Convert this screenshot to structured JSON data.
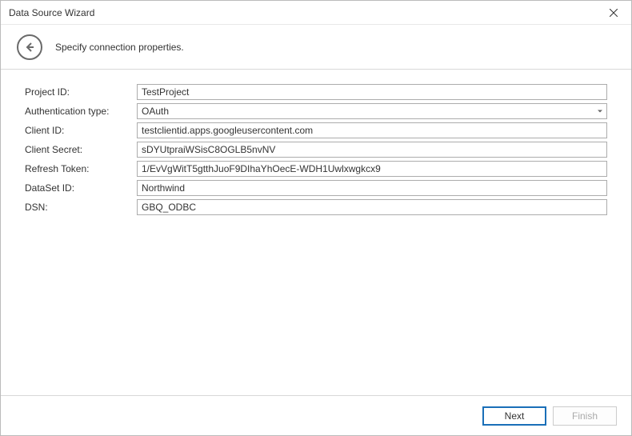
{
  "window": {
    "title": "Data Source Wizard"
  },
  "header": {
    "subtitle": "Specify connection properties."
  },
  "form": {
    "project_id_label": "Project ID:",
    "project_id_value": "TestProject",
    "auth_type_label": "Authentication type:",
    "auth_type_value": "OAuth",
    "client_id_label": "Client ID:",
    "client_id_value": "testclientid.apps.googleusercontent.com",
    "client_secret_label": "Client Secret:",
    "client_secret_value": "sDYUtpraiWSisC8OGLB5nvNV",
    "refresh_token_label": "Refresh Token:",
    "refresh_token_value": "1/EvVgWitT5gtthJuoF9DIhaYhOecE-WDH1Uwlxwgkcx9",
    "dataset_id_label": "DataSet ID:",
    "dataset_id_value": "Northwind",
    "dsn_label": "DSN:",
    "dsn_value": "GBQ_ODBC"
  },
  "footer": {
    "next_label": "Next",
    "finish_label": "Finish"
  }
}
